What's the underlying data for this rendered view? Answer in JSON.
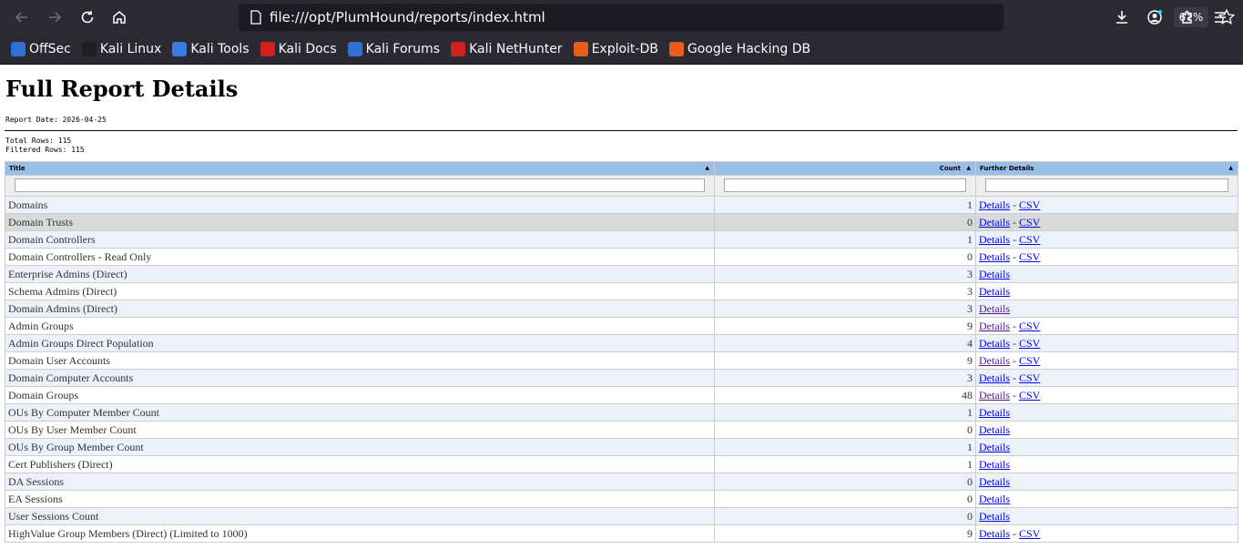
{
  "browser": {
    "url": "file:///opt/PlumHound/reports/index.html",
    "zoom": "67%",
    "bookmarks": [
      {
        "label": "OffSec",
        "icon": "offsec-icon",
        "color": "#2f6fd6"
      },
      {
        "label": "Kali Linux",
        "icon": "kali-dragon-icon",
        "color": "#1f1f1f"
      },
      {
        "label": "Kali Tools",
        "icon": "kali-tools-icon",
        "color": "#3a7be0"
      },
      {
        "label": "Kali Docs",
        "icon": "kali-docs-icon",
        "color": "#d02020"
      },
      {
        "label": "Kali Forums",
        "icon": "kali-forums-icon",
        "color": "#2f6fd6"
      },
      {
        "label": "Kali NetHunter",
        "icon": "nethunter-icon",
        "color": "#d02020"
      },
      {
        "label": "Exploit-DB",
        "icon": "exploit-db-icon",
        "color": "#e85d1a"
      },
      {
        "label": "Google Hacking DB",
        "icon": "ghdb-icon",
        "color": "#e85d1a"
      }
    ]
  },
  "report": {
    "title": "Full Report Details",
    "date": "Report Date: 2026-04-25",
    "total_rows": "Total Rows: 115",
    "filtered_rows": "Filtered Rows: 115",
    "columns": [
      "Title",
      "Count",
      "Further Details"
    ],
    "rows": [
      {
        "title": "Domains",
        "count": "1",
        "details": "Details",
        "csv": "CSV",
        "visited": false
      },
      {
        "title": "Domain Trusts",
        "count": "0",
        "details": "Details",
        "csv": "CSV",
        "visited": false
      },
      {
        "title": "Domain Controllers",
        "count": "1",
        "details": "Details",
        "csv": "CSV",
        "visited": false
      },
      {
        "title": "Domain Controllers - Read Only",
        "count": "0",
        "details": "Details",
        "csv": "CSV",
        "visited": false
      },
      {
        "title": "Enterprise Admins (Direct)",
        "count": "3",
        "details": "Details",
        "csv": "",
        "visited": false
      },
      {
        "title": "Schema Admins (Direct)",
        "count": "3",
        "details": "Details",
        "csv": "",
        "visited": false
      },
      {
        "title": "Domain Admins (Direct)",
        "count": "3",
        "details": "Details",
        "csv": "",
        "visited": true
      },
      {
        "title": "Admin Groups",
        "count": "9",
        "details": "Details",
        "csv": "CSV",
        "visited": true
      },
      {
        "title": "Admin Groups Direct Population",
        "count": "4",
        "details": "Details",
        "csv": "CSV",
        "visited": false
      },
      {
        "title": "Domain User Accounts",
        "count": "9",
        "details": "Details",
        "csv": "CSV",
        "visited": true
      },
      {
        "title": "Domain Computer Accounts",
        "count": "3",
        "details": "Details",
        "csv": "CSV",
        "visited": false
      },
      {
        "title": "Domain Groups",
        "count": "48",
        "details": "Details",
        "csv": "CSV",
        "visited": true
      },
      {
        "title": "OUs By Computer Member Count",
        "count": "1",
        "details": "Details",
        "csv": "",
        "visited": false
      },
      {
        "title": "OUs By User Member Count",
        "count": "0",
        "details": "Details",
        "csv": "",
        "visited": false
      },
      {
        "title": "OUs By Group Member Count",
        "count": "1",
        "details": "Details",
        "csv": "",
        "visited": false
      },
      {
        "title": "Cert Publishers (Direct)",
        "count": "1",
        "details": "Details",
        "csv": "",
        "visited": false
      },
      {
        "title": "DA Sessions",
        "count": "0",
        "details": "Details",
        "csv": "",
        "visited": false
      },
      {
        "title": "EA Sessions",
        "count": "0",
        "details": "Details",
        "csv": "",
        "visited": false
      },
      {
        "title": "User Sessions Count",
        "count": "0",
        "details": "Details",
        "csv": "",
        "visited": false
      },
      {
        "title": "HighValue Group Members (Direct) (Limited to 1000)",
        "count": "9",
        "details": "Details",
        "csv": "CSV",
        "visited": false
      }
    ]
  }
}
